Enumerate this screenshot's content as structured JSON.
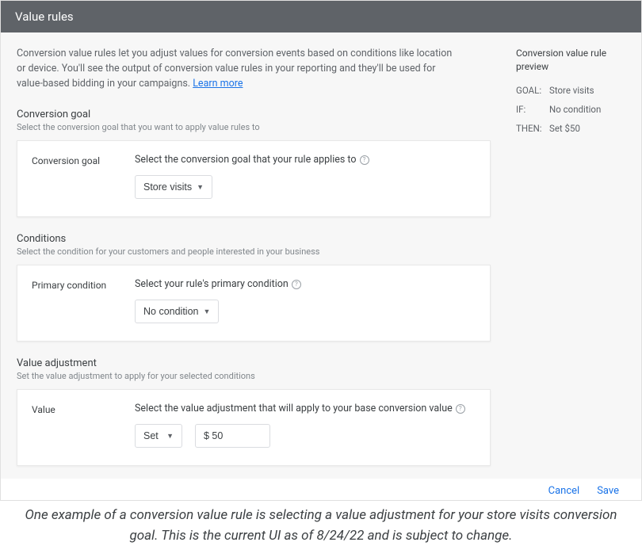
{
  "header": {
    "title": "Value rules"
  },
  "intro": {
    "text": "Conversion value rules let you adjust values for conversion events based on conditions like location or device. You'll see the output of conversion value rules in your reporting and they'll be used for value-based bidding in your campaigns. ",
    "learn_more": "Learn more"
  },
  "sections": {
    "goal": {
      "title": "Conversion goal",
      "sub": "Select the conversion goal that you want to apply value rules to",
      "row_label": "Conversion goal",
      "field_title": "Select the conversion goal that your rule applies to",
      "dropdown_value": "Store visits"
    },
    "conditions": {
      "title": "Conditions",
      "sub": "Select the condition for your customers and people interested in your business",
      "row_label": "Primary condition",
      "field_title": "Select your rule's primary condition",
      "dropdown_value": "No condition"
    },
    "value": {
      "title": "Value adjustment",
      "sub": "Set the value adjustment to apply for your selected conditions",
      "row_label": "Value",
      "field_title": "Select the value adjustment that will apply to your base conversion value",
      "action_dropdown": "Set",
      "amount": "$ 50"
    }
  },
  "preview": {
    "title": "Conversion value rule preview",
    "goal_label": "GOAL:",
    "goal_value": "Store visits",
    "if_label": "IF:",
    "if_value": "No condition",
    "then_label": "THEN:",
    "then_value": "Set $50"
  },
  "footer": {
    "cancel": "Cancel",
    "save": "Save"
  },
  "caption": "One example of a conversion value rule is selecting a value adjustment for your store visits conversion goal. This is the current UI as of 8/24/22 and is subject to change."
}
